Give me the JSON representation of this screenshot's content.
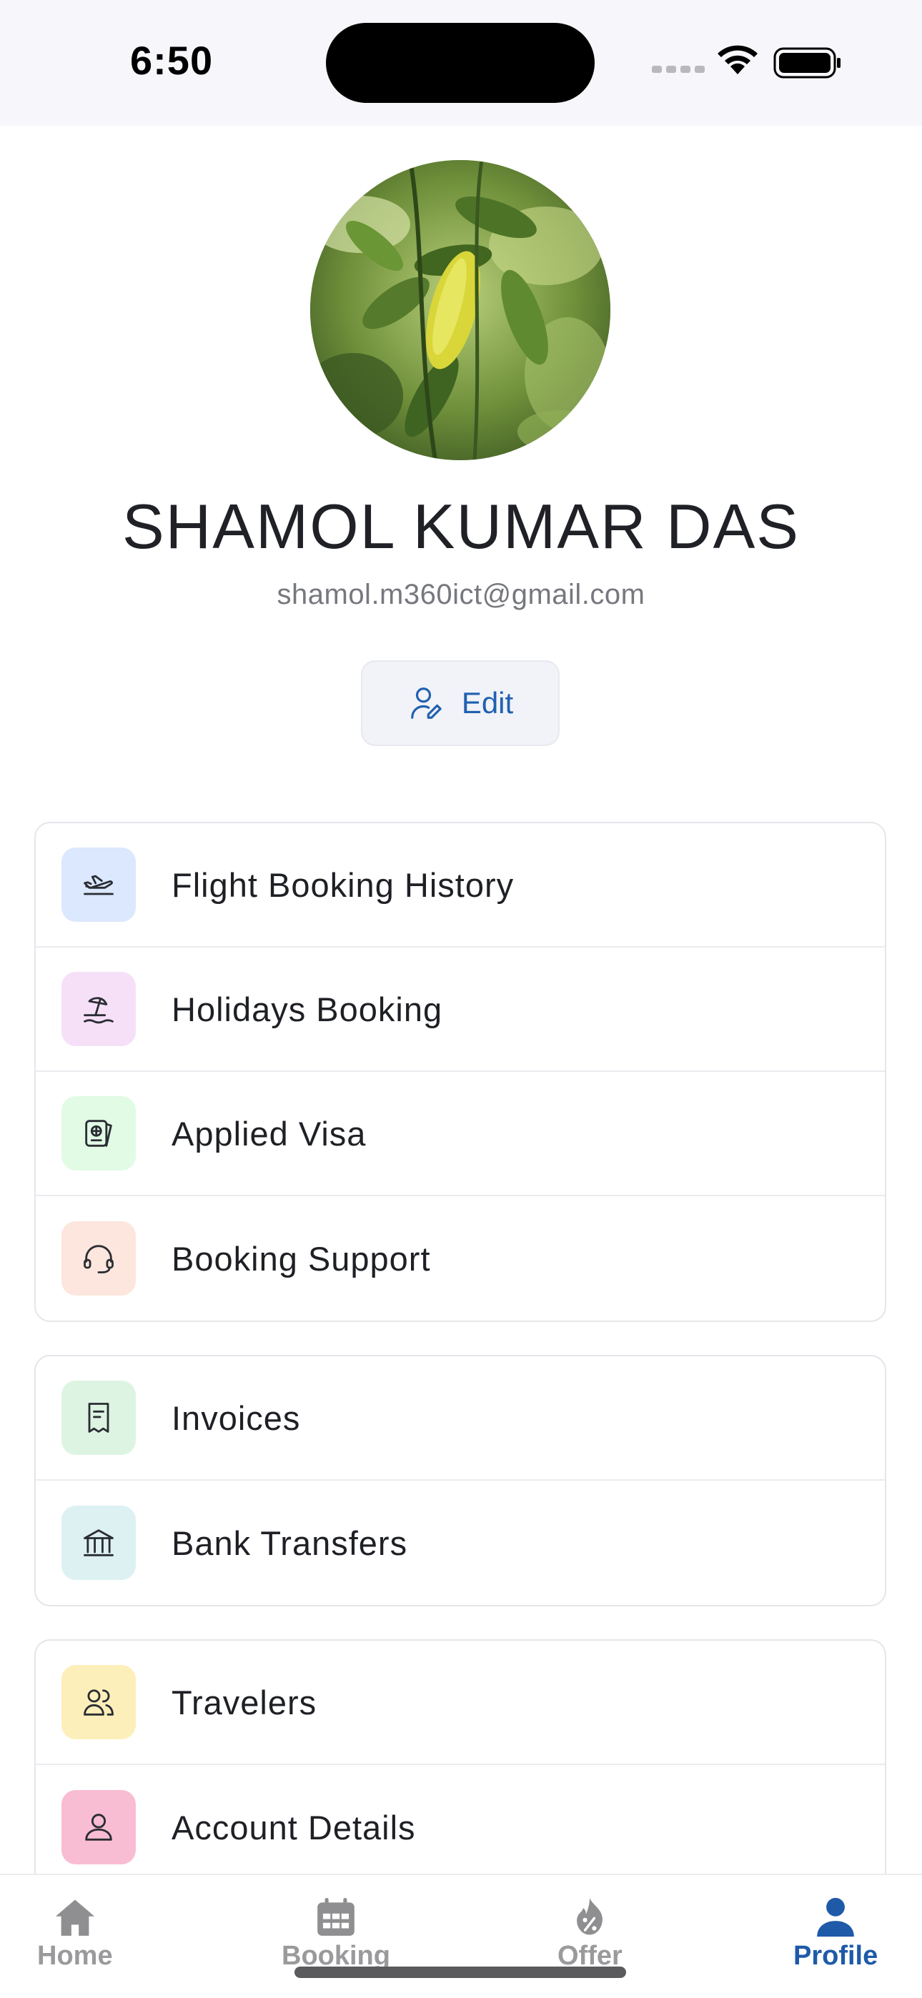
{
  "status_bar": {
    "time": "6:50",
    "icons": [
      "cellular-signal-icon",
      "wifi-icon",
      "battery-icon"
    ]
  },
  "profile": {
    "avatar": "avatar-photo-green-leaves",
    "name": "SHAMOL KUMAR DAS",
    "email": "shamol.m360ict@gmail.com",
    "edit_label": "Edit",
    "edit_icon": "user-edit-icon"
  },
  "menu_groups": [
    {
      "items": [
        {
          "label": "Flight Booking History",
          "icon": "airplane-takeoff-icon",
          "bg": "#dbe8fd"
        },
        {
          "label": "Holidays Booking",
          "icon": "beach-umbrella-icon",
          "bg": "#f6e0f8"
        },
        {
          "label": "Applied Visa",
          "icon": "passport-icon",
          "bg": "#e1fbe5"
        },
        {
          "label": "Booking Support",
          "icon": "headset-icon",
          "bg": "#fde6dd"
        }
      ]
    },
    {
      "items": [
        {
          "label": "Invoices",
          "icon": "receipt-icon",
          "bg": "#def4e2"
        },
        {
          "label": "Bank Transfers",
          "icon": "bank-icon",
          "bg": "#ddf1f3"
        }
      ]
    },
    {
      "items": [
        {
          "label": "Travelers",
          "icon": "users-icon",
          "bg": "#fdefb9"
        },
        {
          "label": "Account Details",
          "icon": "user-icon",
          "bg": "#f8bcd3"
        }
      ]
    }
  ],
  "bottom_nav": [
    {
      "label": "Home",
      "icon": "home-icon",
      "active": false
    },
    {
      "label": "Booking",
      "icon": "calendar-icon",
      "active": false
    },
    {
      "label": "Offer",
      "icon": "discount-flame-icon",
      "active": false
    },
    {
      "label": "Profile",
      "icon": "profile-icon",
      "active": true
    }
  ],
  "colors": {
    "accent": "#1e5aa8",
    "inactive_nav": "#9a9a9c",
    "card_border": "#e5e6ea"
  }
}
